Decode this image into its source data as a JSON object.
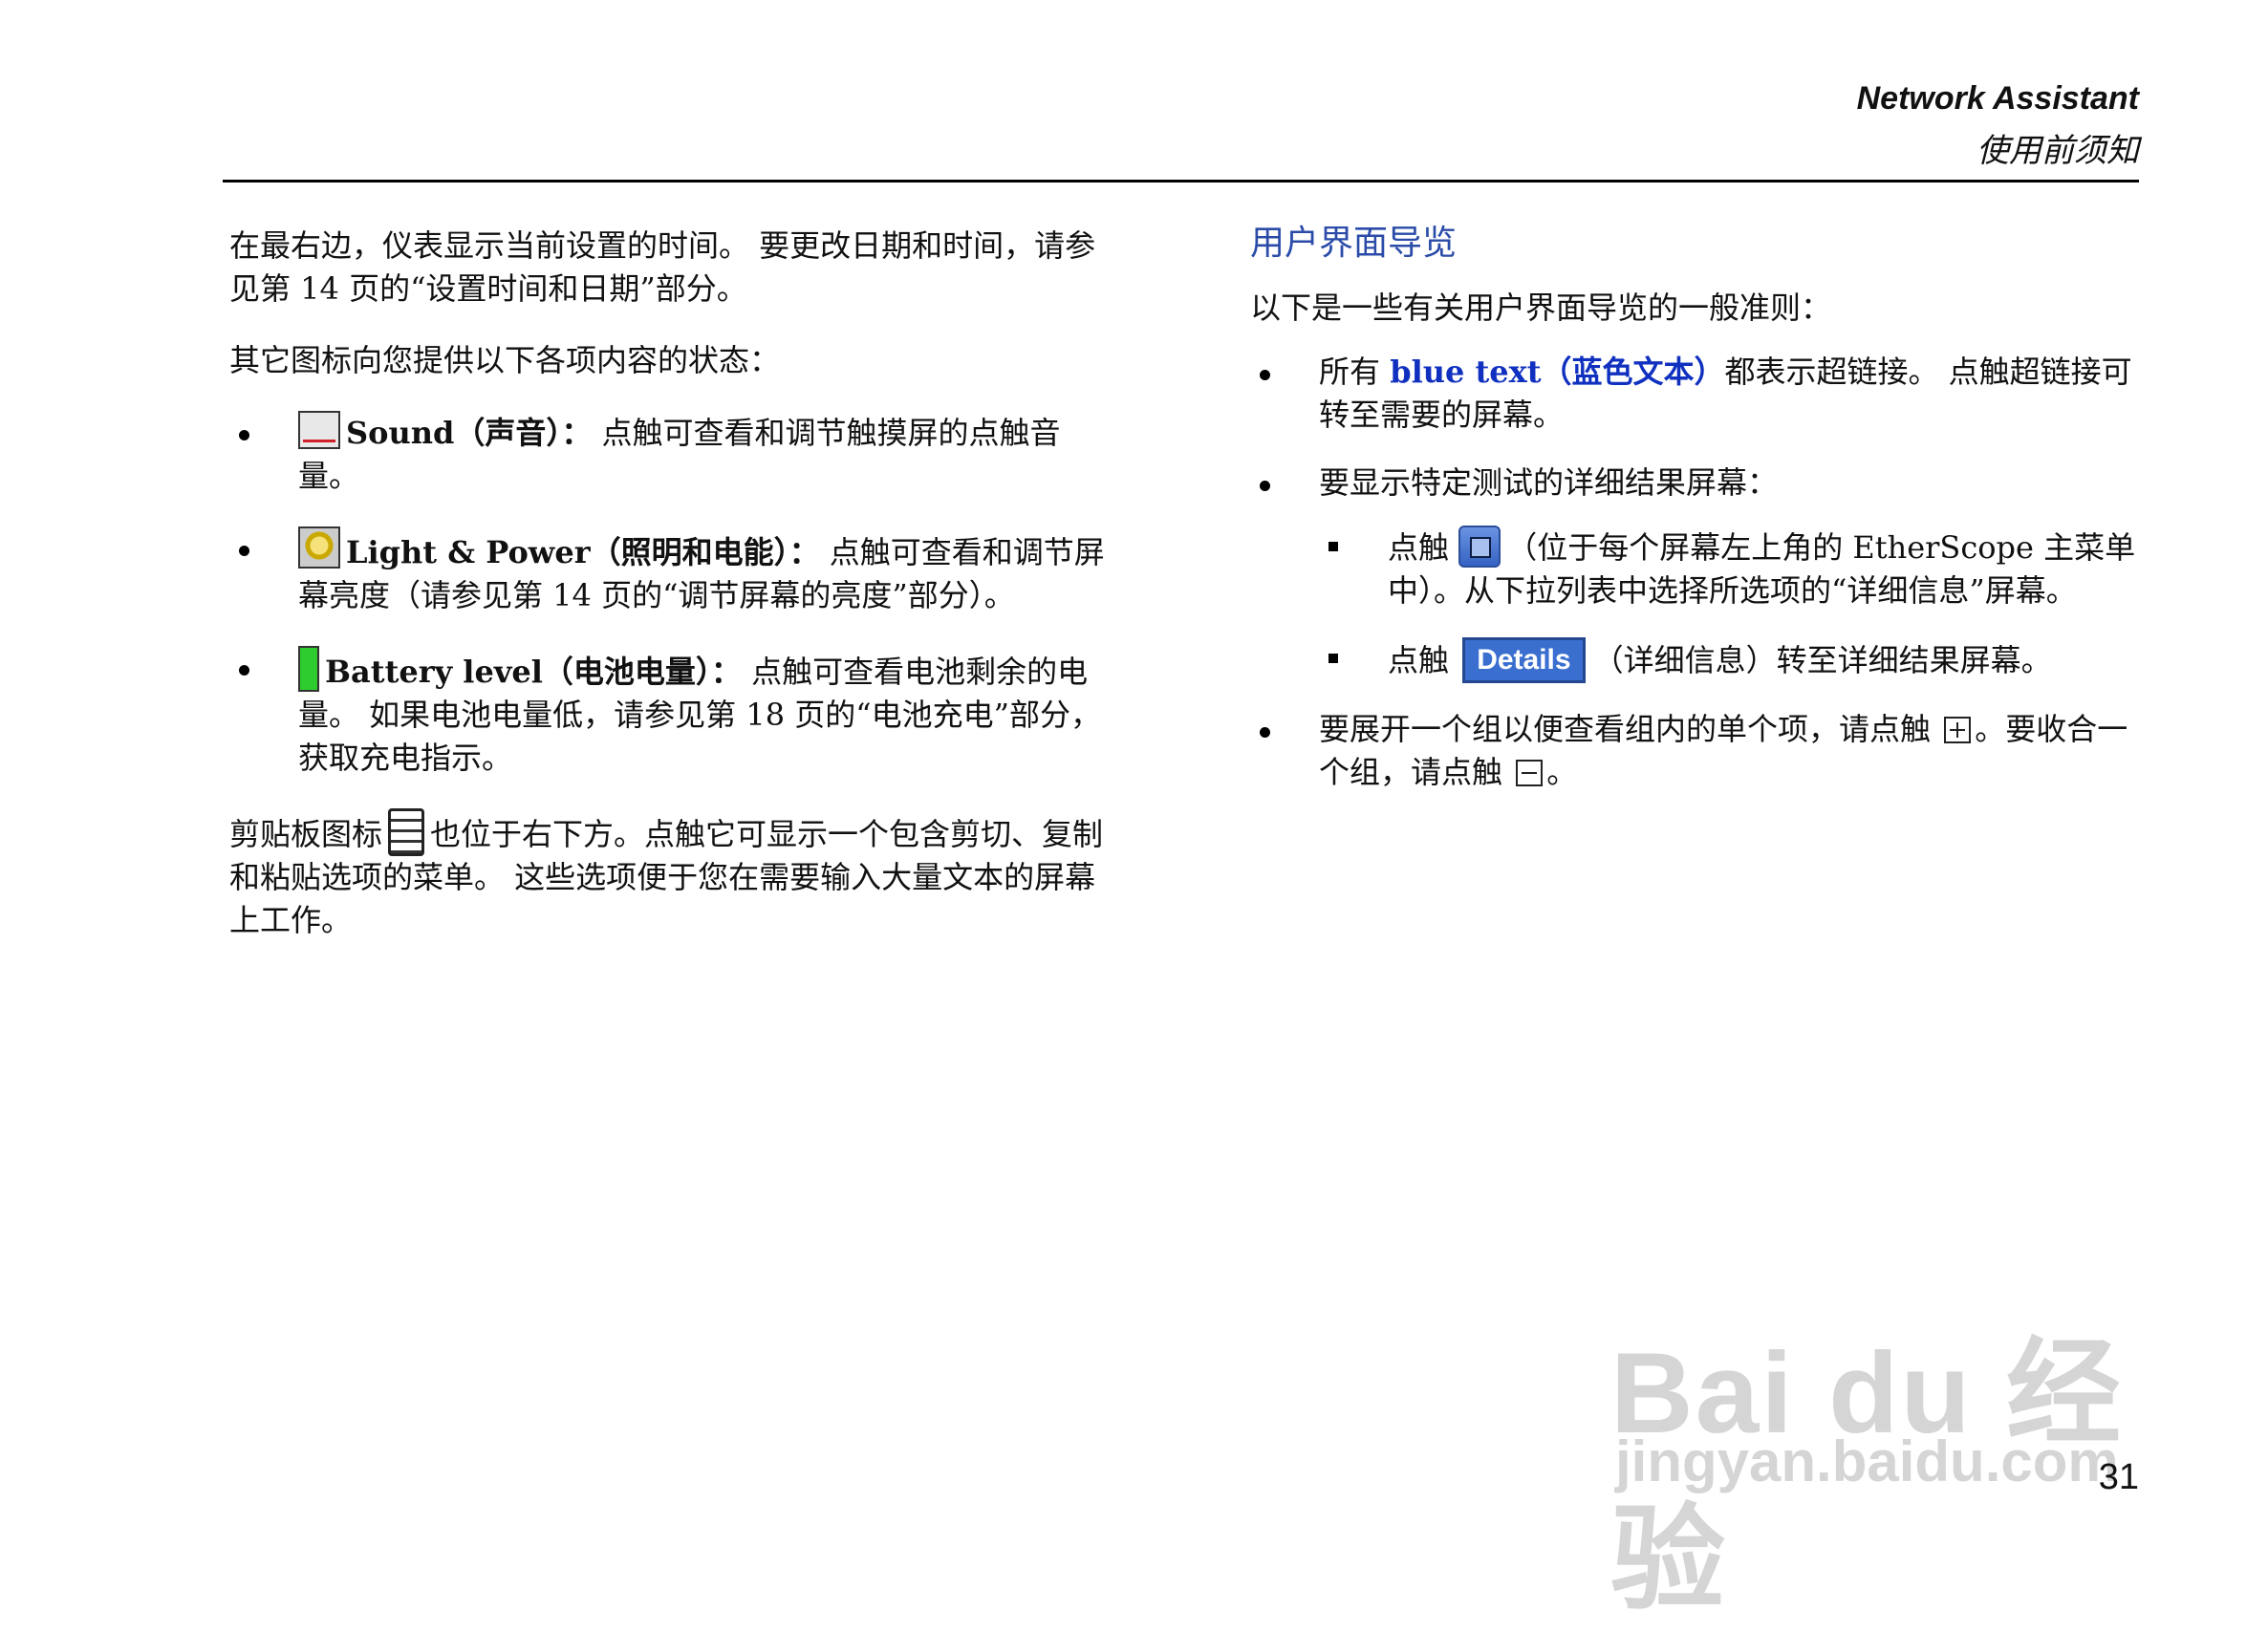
{
  "header": {
    "title": "Network Assistant",
    "subtitle": "使用前须知"
  },
  "left": {
    "p1": "在最右边，仪表显示当前设置的时间。 要更改日期和时间，请参见第 14 页的“设置时间和日期”部分。",
    "p2": "其它图标向您提供以下各项内容的状态：",
    "items": [
      {
        "icon": "speaker-icon",
        "label": "Sound（声音）：",
        "text": " 点触可查看和调节触摸屏的点触音量。"
      },
      {
        "icon": "light-bulb-icon",
        "label": "Light & Power（照明和电能）：",
        "text": " 点触可查看和调节屏幕亮度（请参见第 14 页的“调节屏幕的亮度”部分）。"
      },
      {
        "icon": "battery-icon",
        "label": "Battery level（电池电量）：",
        "text": " 点触可查看电池剩余的电量。 如果电池电量低，请参见第 18 页的“电池充电”部分，获取充电指示。"
      }
    ],
    "clip_before": "剪贴板图标",
    "clip_after": "也位于右下方。点触它可显示一个包含剪切、复制和粘贴选项的菜单。 这些选项便于您在需要输入大量文本的屏幕上工作。"
  },
  "right": {
    "heading": "用户界面导览",
    "intro": "以下是一些有关用户界面导览的一般准则：",
    "b1_prefix": "所有 ",
    "b1_link": "blue text（蓝色文本）",
    "b1_suffix": "都表示超链接。 点触超链接可转至需要的屏幕。",
    "b2": "要显示特定测试的详细结果屏幕：",
    "s1_prefix": "点触 ",
    "s1_suffix": "（位于每个屏幕左上角的 EtherScope 主菜单中）。从下拉列表中选择所选项的“详细信息”屏幕。",
    "s2_prefix": "点触 ",
    "s2_button": "Details",
    "s2_suffix": "（详细信息）转至详细结果屏幕。",
    "b3_prefix": "要展开一个组以便查看组内的单个项，请点触 ",
    "b3_mid": "。要收合一个组，请点触 ",
    "b3_end": "。"
  },
  "watermark": {
    "logo": "Bai du 经验",
    "url": "jingyan.baidu.com"
  },
  "page_number": "31"
}
